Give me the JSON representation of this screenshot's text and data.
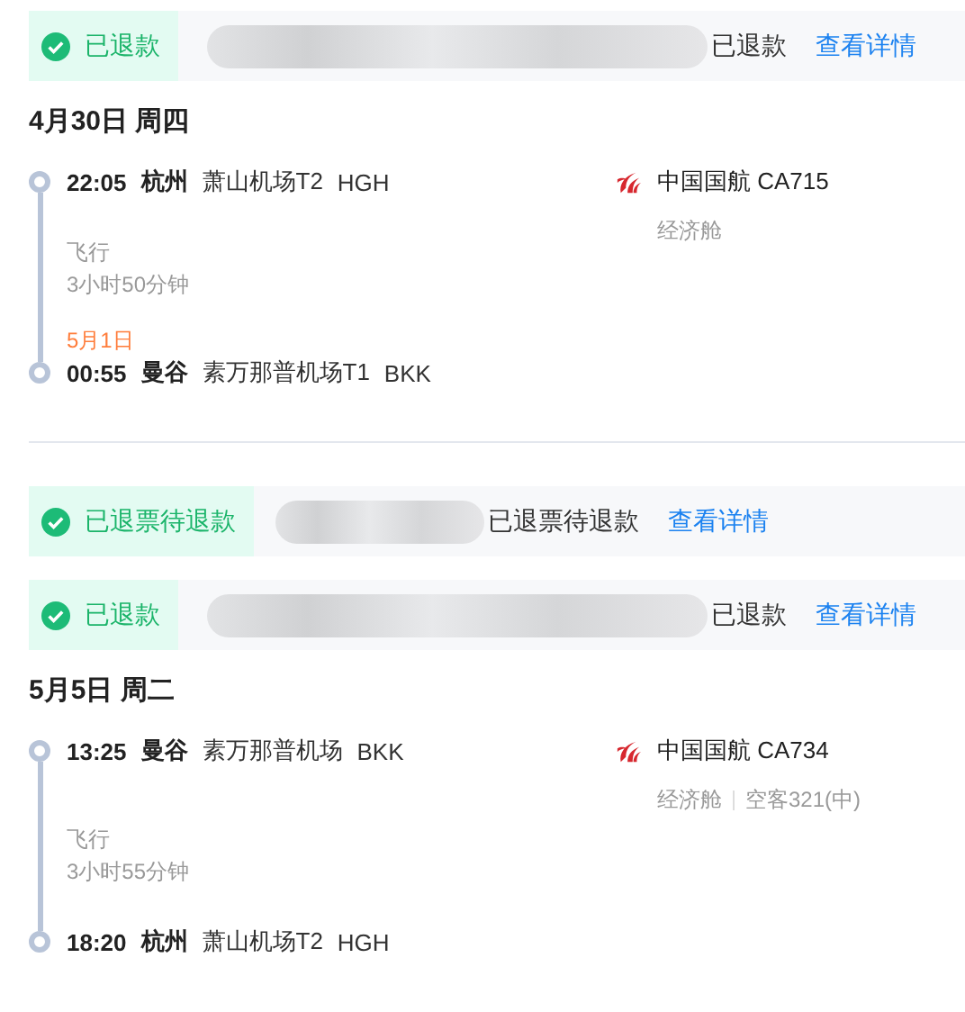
{
  "blocks": [
    {
      "kind": "status",
      "badge": "已退款",
      "redaction": {
        "kind": "long"
      },
      "status": "已退款",
      "link": "查看详情"
    },
    {
      "kind": "trip",
      "date": "4月30日 周四",
      "depart": {
        "time": "22:05",
        "city": "杭州",
        "airport": "萧山机场T2",
        "code": "HGH"
      },
      "duration_label": "飞行",
      "duration": "3小时50分钟",
      "arrive": {
        "date_note": "5月1日",
        "time": "00:55",
        "city": "曼谷",
        "airport": "素万那普机场T1",
        "code": "BKK"
      },
      "airline": "中国国航 CA715",
      "cabin": [
        "经济舱"
      ],
      "divider_after": true
    },
    {
      "kind": "status",
      "badge": "已退票待退款",
      "redaction": {
        "kind": "short"
      },
      "status": "已退票待退款",
      "link": "查看详情"
    },
    {
      "kind": "status",
      "badge": "已退款",
      "redaction": {
        "kind": "long"
      },
      "status": "已退款",
      "link": "查看详情"
    },
    {
      "kind": "trip",
      "date": "5月5日 周二",
      "depart": {
        "time": "13:25",
        "city": "曼谷",
        "airport": "素万那普机场",
        "code": "BKK"
      },
      "duration_label": "飞行",
      "duration": "3小时55分钟",
      "arrive": {
        "time": "18:20",
        "city": "杭州",
        "airport": "萧山机场T2",
        "code": "HGH"
      },
      "airline": "中国国航 CA734",
      "cabin": [
        "经济舱",
        "空客321(中)"
      ],
      "divider_after": false
    }
  ]
}
